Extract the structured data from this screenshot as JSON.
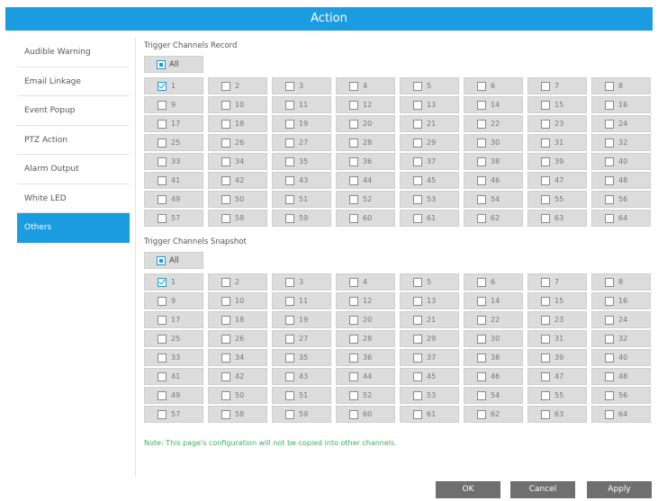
{
  "title": "Action",
  "sidebar": {
    "items": [
      {
        "label": "Audible Warning",
        "active": false
      },
      {
        "label": "Email Linkage",
        "active": false
      },
      {
        "label": "Event Popup",
        "active": false
      },
      {
        "label": "PTZ Action",
        "active": false
      },
      {
        "label": "Alarm Output",
        "active": false
      },
      {
        "label": "White LED",
        "active": false
      },
      {
        "label": "Others",
        "active": true
      }
    ]
  },
  "record": {
    "title": "Trigger Channels Record",
    "all_label": "All",
    "all_state": "partial",
    "checked_channels": [
      1
    ]
  },
  "snapshot": {
    "title": "Trigger Channels Snapshot",
    "all_label": "All",
    "all_state": "partial",
    "checked_channels": [
      1
    ]
  },
  "channel_count": 64,
  "note": "Note: This page's configuration will not be copied into other channels.",
  "buttons": {
    "ok": "OK",
    "cancel": "Cancel",
    "apply": "Apply"
  },
  "colors": {
    "accent": "#1b9be0",
    "note": "#3fae5e",
    "button": "#6f6f6f"
  }
}
